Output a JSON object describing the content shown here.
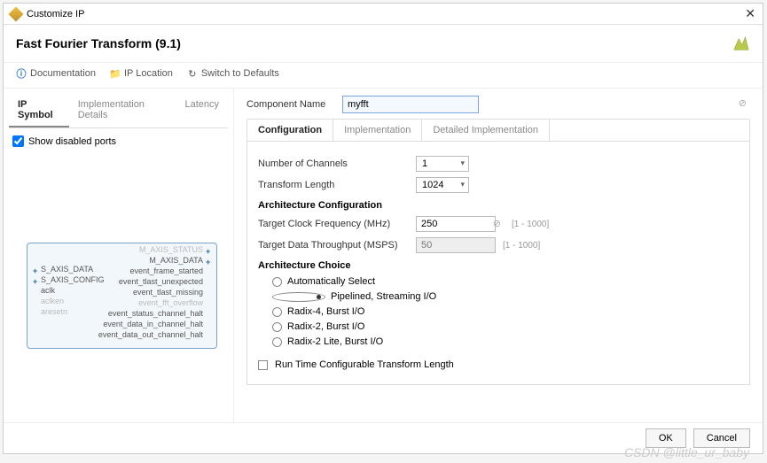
{
  "titlebar": {
    "title": "Customize IP"
  },
  "header": {
    "title": "Fast Fourier Transform (9.1)"
  },
  "toolbar": {
    "documentation": "Documentation",
    "ip_location": "IP Location",
    "switch_defaults": "Switch to Defaults"
  },
  "left": {
    "tabs": [
      "IP Symbol",
      "Implementation Details",
      "Latency"
    ],
    "active_tab": 0,
    "show_disabled_label": "Show disabled ports",
    "show_disabled_checked": true,
    "ports_left": [
      {
        "name": "S_AXIS_DATA",
        "disabled": false,
        "pin": "+"
      },
      {
        "name": "S_AXIS_CONFIG",
        "disabled": false,
        "pin": "+"
      },
      {
        "name": "aclk",
        "disabled": false,
        "pin": ""
      },
      {
        "name": "aclken",
        "disabled": true,
        "pin": ""
      },
      {
        "name": "aresetn",
        "disabled": true,
        "pin": ""
      }
    ],
    "ports_right": [
      {
        "name": "M_AXIS_STATUS",
        "disabled": true,
        "pin": "+"
      },
      {
        "name": "M_AXIS_DATA",
        "disabled": false,
        "pin": "+"
      },
      {
        "name": "event_frame_started",
        "disabled": false,
        "pin": ""
      },
      {
        "name": "event_tlast_unexpected",
        "disabled": false,
        "pin": ""
      },
      {
        "name": "event_tlast_missing",
        "disabled": false,
        "pin": ""
      },
      {
        "name": "event_fft_overflow",
        "disabled": true,
        "pin": ""
      },
      {
        "name": "event_status_channel_halt",
        "disabled": false,
        "pin": ""
      },
      {
        "name": "event_data_in_channel_halt",
        "disabled": false,
        "pin": ""
      },
      {
        "name": "event_data_out_channel_halt",
        "disabled": false,
        "pin": ""
      }
    ]
  },
  "right": {
    "component_name_label": "Component Name",
    "component_name_value": "myfft",
    "tabs": [
      "Configuration",
      "Implementation",
      "Detailed Implementation"
    ],
    "active_tab": 0,
    "num_channels_label": "Number of Channels",
    "num_channels_value": "1",
    "transform_len_label": "Transform Length",
    "transform_len_value": "1024",
    "arch_config_head": "Architecture Configuration",
    "clock_freq_label": "Target Clock Frequency (MHz)",
    "clock_freq_value": "250",
    "clock_freq_range": "[1 - 1000]",
    "throughput_label": "Target Data Throughput (MSPS)",
    "throughput_value": "50",
    "throughput_range": "[1 - 1000]",
    "arch_choice_head": "Architecture Choice",
    "arch_options": [
      "Automatically Select",
      "Pipelined, Streaming I/O",
      "Radix-4, Burst I/O",
      "Radix-2, Burst I/O",
      "Radix-2 Lite, Burst I/O"
    ],
    "arch_selected": 1,
    "runtime_label": "Run Time Configurable Transform Length",
    "runtime_checked": false
  },
  "footer": {
    "ok": "OK",
    "cancel": "Cancel"
  },
  "watermark": "CSDN @little_ur_baby"
}
